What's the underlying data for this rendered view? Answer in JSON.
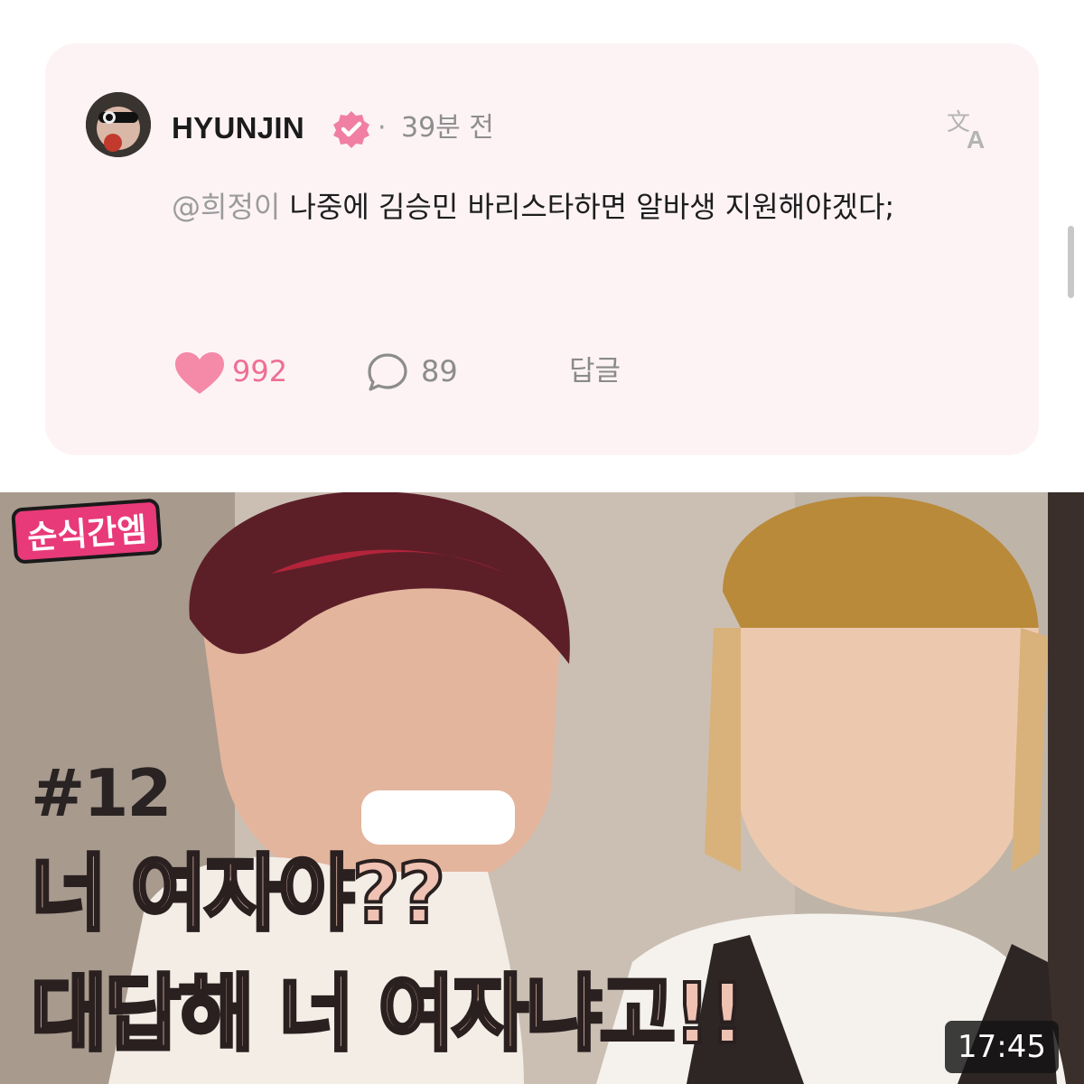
{
  "post": {
    "username": "HYUNJIN",
    "separator": "·",
    "time": "39분 전",
    "mention": "@희정이",
    "text": " 나중에 김승민 바리스타하면 알바생 지원해야겠다;",
    "likes": "992",
    "comments": "89",
    "reply_label": "답글"
  },
  "video": {
    "series_tag": "순식간엠",
    "episode": "#12",
    "headline_line1": "너 여자야??",
    "headline_line2": "대답해 너 여자냐고!!",
    "duration": "17:45"
  },
  "colors": {
    "card_bg": "#fdf3f5",
    "accent_pink": "#ee6e94",
    "verified_badge": "#f07fa3",
    "headline_fill": "#efc2b3"
  },
  "icons": {
    "verified": "verified-badge-icon",
    "translate": "translate-icon",
    "like": "heart-icon",
    "comment": "comment-bubble-icon"
  }
}
